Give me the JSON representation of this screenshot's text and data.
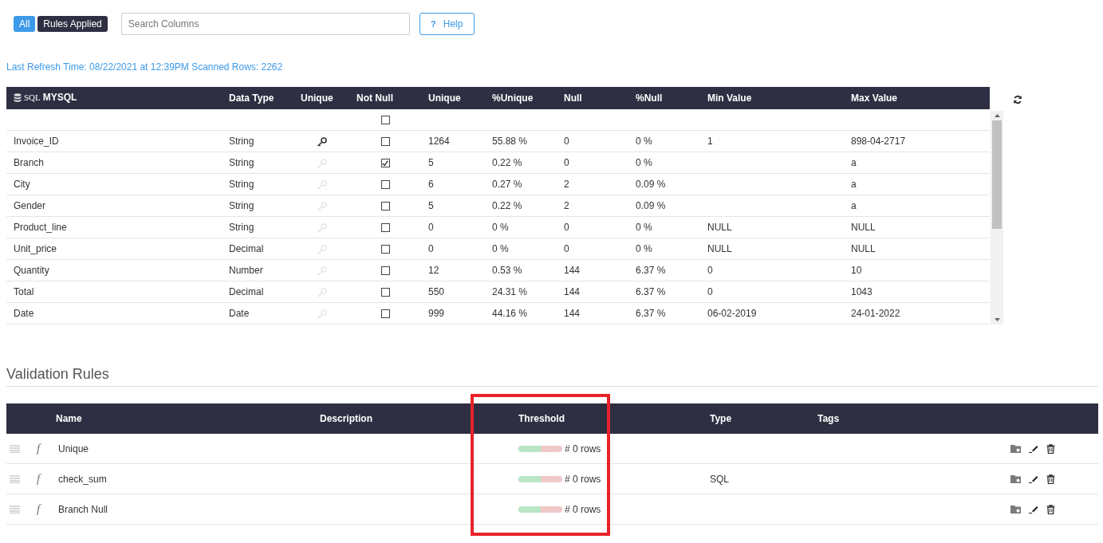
{
  "filters": [
    {
      "label": "All",
      "selected": true
    },
    {
      "label": "Rules Applied",
      "selected": false
    }
  ],
  "search": {
    "placeholder": "Search Columns"
  },
  "help_button": {
    "icon": "?",
    "label": "Help"
  },
  "refresh_info": "Last Refresh Time: 08/22/2021 at 12:39PM Scanned Rows: 2262",
  "profile_table": {
    "source_tag": "SQL",
    "source": "MYSQL",
    "columns": [
      "Data Type",
      "Unique",
      "Not Null",
      "Unique",
      "%Unique",
      "Null",
      "%Null",
      "Min Value",
      "Max Value"
    ],
    "filter_row": {
      "not_null": false
    },
    "rows": [
      {
        "name": "Invoice_ID",
        "data_type": "String",
        "unique": true,
        "not_null": false,
        "unique_count": "1264",
        "pct_unique": "55.88 %",
        "null": "0",
        "pct_null": "0 %",
        "min": "1",
        "max": "898-04-2717"
      },
      {
        "name": "Branch",
        "data_type": "String",
        "unique": false,
        "not_null": true,
        "unique_count": "5",
        "pct_unique": "0.22 %",
        "null": "0",
        "pct_null": "0 %",
        "min": "",
        "max": "a"
      },
      {
        "name": "City",
        "data_type": "String",
        "unique": false,
        "not_null": false,
        "unique_count": "6",
        "pct_unique": "0.27 %",
        "null": "2",
        "pct_null": "0.09 %",
        "min": "",
        "max": "a"
      },
      {
        "name": "Gender",
        "data_type": "String",
        "unique": false,
        "not_null": false,
        "unique_count": "5",
        "pct_unique": "0.22 %",
        "null": "2",
        "pct_null": "0.09 %",
        "min": "",
        "max": "a"
      },
      {
        "name": "Product_line",
        "data_type": "String",
        "unique": false,
        "not_null": false,
        "unique_count": "0",
        "pct_unique": "0 %",
        "null": "0",
        "pct_null": "0 %",
        "min": "NULL",
        "max": "NULL"
      },
      {
        "name": "Unit_price",
        "data_type": "Decimal",
        "unique": false,
        "not_null": false,
        "unique_count": "0",
        "pct_unique": "0 %",
        "null": "0",
        "pct_null": "0 %",
        "min": "NULL",
        "max": "NULL"
      },
      {
        "name": "Quantity",
        "data_type": "Number",
        "unique": false,
        "not_null": false,
        "unique_count": "12",
        "pct_unique": "0.53 %",
        "null": "144",
        "pct_null": "6.37 %",
        "min": "0",
        "max": "10"
      },
      {
        "name": "Total",
        "data_type": "Decimal",
        "unique": false,
        "not_null": false,
        "unique_count": "550",
        "pct_unique": "24.31 %",
        "null": "144",
        "pct_null": "6.37 %",
        "min": "0",
        "max": "1043"
      },
      {
        "name": "Date",
        "data_type": "Date",
        "unique": false,
        "not_null": false,
        "unique_count": "999",
        "pct_unique": "44.16 %",
        "null": "144",
        "pct_null": "6.37 %",
        "min": "06-02-2019",
        "max": "24-01-2022"
      }
    ]
  },
  "validation": {
    "title": "Validation Rules",
    "highlight_threshold": true,
    "columns": [
      "Name",
      "Description",
      "Threshold",
      "Type",
      "Tags"
    ],
    "rules": [
      {
        "icon": "f",
        "name": "Unique",
        "level": 0.5,
        "threshold": "# 0 rows"
      },
      {
        "icon": "f",
        "name": "check_sum",
        "level": 0.5,
        "threshold": "# 0 rows",
        "type": "SQL"
      },
      {
        "icon": "f",
        "name": "Branch Null",
        "level": 0.5,
        "threshold": "# 0 rows"
      }
    ]
  }
}
